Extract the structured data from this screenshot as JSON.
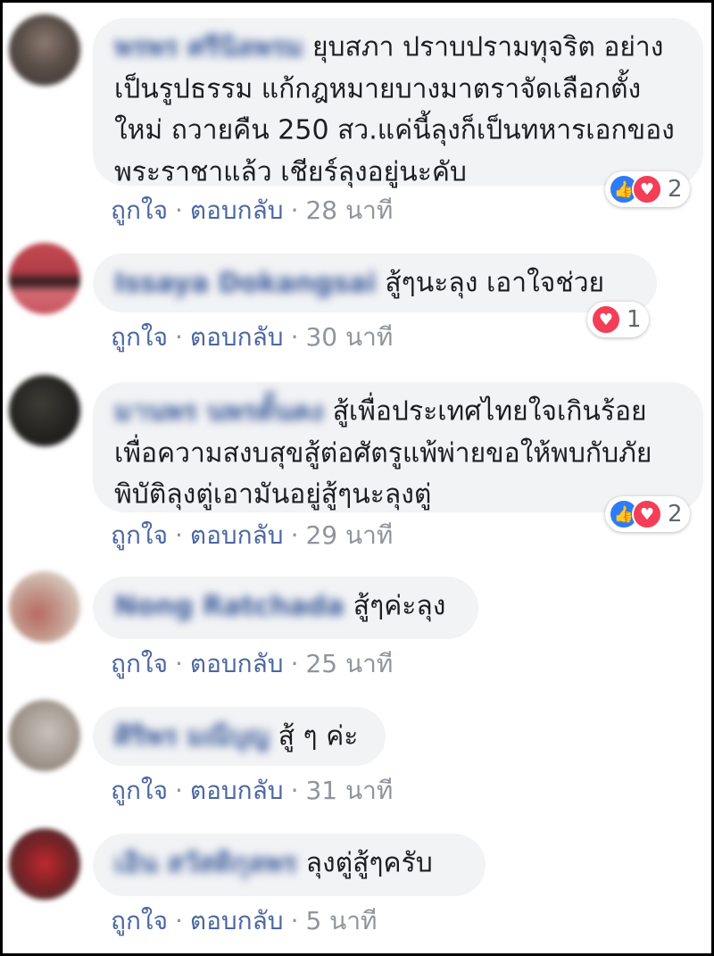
{
  "actions": {
    "like": "ถูกใจ",
    "reply": "ตอบกลับ",
    "separator": "·"
  },
  "colors": {
    "bubble": "#f2f3f5",
    "link": "#4b67a1",
    "like": "#2e7bf6",
    "love": "#f33e58"
  },
  "comments": [
    {
      "author": "พรพร ศรีนิลพรม",
      "text": "ยุบสภา ปราบปรามทุจริต อย่างเป็นรูปธรรม แก้กฎหมายบางมาตราจัดเลือกตั้งใหม่ ถวายคืน 250 สว.แค่นี้ลุงก็เป็นทหารเอกของพระราชาแล้ว เชียร์ลุงอยู่นะคับ",
      "time": "28 นาที",
      "reactions": {
        "icons": [
          "like-icon",
          "love-icon"
        ],
        "count": "2"
      }
    },
    {
      "author": "Issaya Dokangsai",
      "text": "สู้ๆนะลุง เอาใจช่วย",
      "time": "30 นาที",
      "reactions": {
        "icons": [
          "love-icon"
        ],
        "count": "1"
      }
    },
    {
      "author": "มานพร นพรตั้นคง",
      "text": "สู้เพื่อประเทศไทยใจเกินร้อยเพื่อความสงบสุขสู้ต่อศัตรูแพ้พ่ายขอให้พบกับภัยพิบัติลุงตู่เอามันอยู่สู้ๆนะลุงตู่",
      "time": "29 นาที",
      "reactions": {
        "icons": [
          "like-icon",
          "love-icon"
        ],
        "count": "2"
      }
    },
    {
      "author": "Nong Ratchada",
      "text": "สู้ๆค่ะลุง",
      "time": "25 นาที",
      "reactions": null
    },
    {
      "author": "ศิริพร มณีบุญ",
      "text": "สู้ ๆ ค่ะ",
      "time": "31 นาที",
      "reactions": null
    },
    {
      "author": "เอิน สวัสดิกุลพร",
      "text": "ลุงตู่สู้ๆครับ",
      "time": "5 นาที",
      "reactions": null
    }
  ]
}
